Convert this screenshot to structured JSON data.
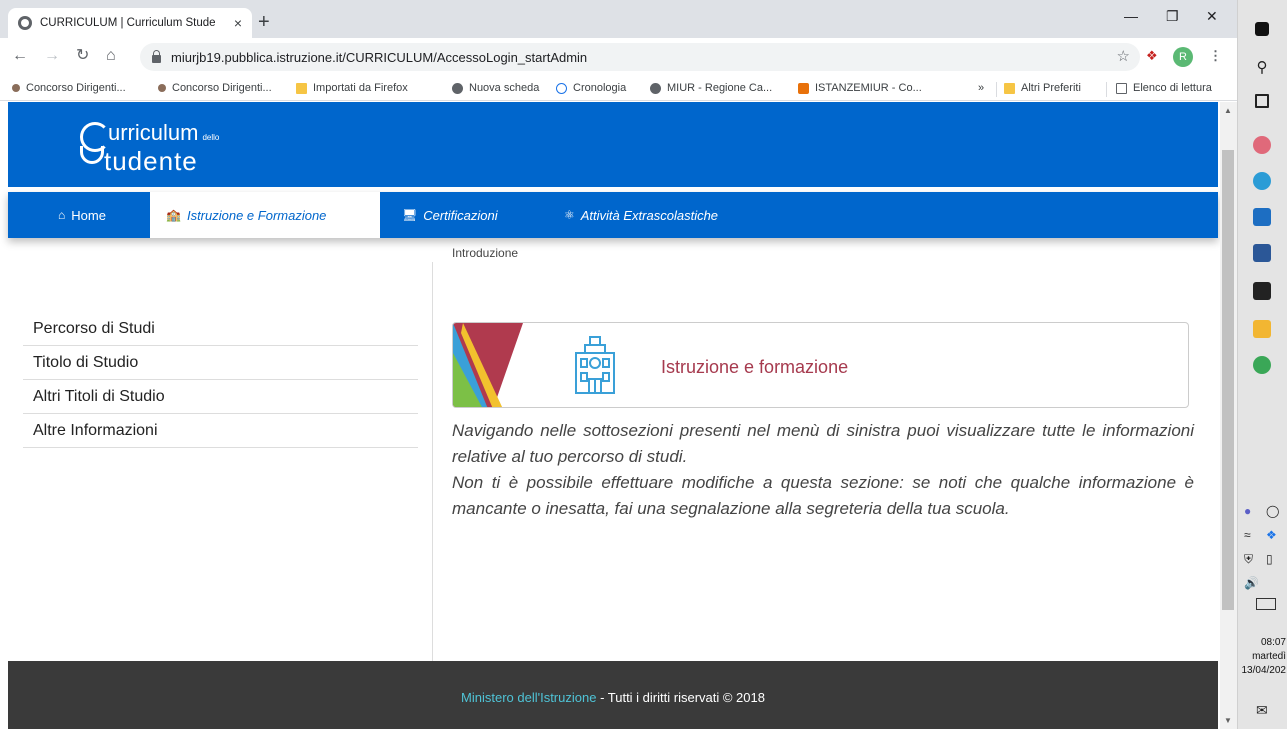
{
  "browser": {
    "tab_title": "CURRICULUM | Curriculum Stude",
    "tab_close": "×",
    "new_tab": "+",
    "url": "miurjb19.pubblica.istruzione.it/CURRICULUM/AccessoLogin_startAdmin",
    "profile_initial": "R",
    "bookmarks": [
      {
        "label": "Concorso Dirigenti...",
        "icon": "concorso-icon"
      },
      {
        "label": "Concorso Dirigenti...",
        "icon": "concorso-icon"
      },
      {
        "label": "Importati da Firefox",
        "icon": "folder-icon"
      },
      {
        "label": "Nuova scheda",
        "icon": "globe-icon"
      },
      {
        "label": "Cronologia",
        "icon": "history-icon"
      },
      {
        "label": "MIUR - Regione Ca...",
        "icon": "globe-icon"
      },
      {
        "label": "ISTANZEMIUR - Co...",
        "icon": "istanze-icon"
      }
    ],
    "bookmarks_more": "»",
    "other_bookmarks": "Altri Preferiti",
    "reading_list": "Elenco di lettura"
  },
  "site": {
    "logo_line1": "urriculum",
    "logo_small": "dello",
    "logo_line2": "tudente",
    "nav": [
      {
        "label": "Home",
        "icon": "home-icon"
      },
      {
        "label": "Istruzione e Formazione",
        "icon": "school-icon"
      },
      {
        "label": "Certificazioni",
        "icon": "certificate-icon"
      },
      {
        "label": "Attività Extrascolastiche",
        "icon": "activity-icon"
      }
    ],
    "sidebar": [
      "Percorso di Studi",
      "Titolo di Studio",
      "Altri Titoli di Studio",
      "Altre Informazioni"
    ],
    "breadcrumb": "Introduzione",
    "card_title": "Istruzione e formazione",
    "intro_p1": "Navigando nelle sottosezioni presenti nel menù di sinistra puoi visualizzare tutte le informazioni relative al tuo percorso di studi.",
    "intro_p2": "Non ti è possibile effettuare modifiche a questa sezione: se noti che qualche informazione è mancante o inesatta, fai una segnalazione alla segreteria della tua scuola.",
    "footer_link": "Ministero dell'Istruzione",
    "footer_rest": " - Tutti i diritti riservati © 2018"
  },
  "taskbar": {
    "time": "08:07",
    "day": "martedì",
    "date": "13/04/202"
  }
}
